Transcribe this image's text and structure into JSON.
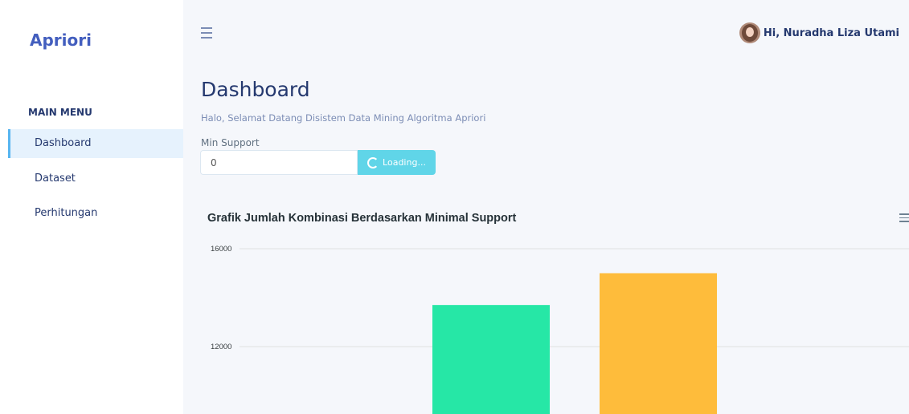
{
  "app": {
    "brand": "Apriori"
  },
  "sidebar": {
    "menu_title": "MAIN MENU",
    "items": [
      {
        "label": "Dashboard",
        "active": true
      },
      {
        "label": "Dataset",
        "active": false
      },
      {
        "label": "Perhitungan",
        "active": false
      }
    ]
  },
  "header": {
    "menu_icon": "hamburger-icon",
    "user_greeting": "Hi, Nuradha Liza Utami"
  },
  "main": {
    "title": "Dashboard",
    "subtitle": "Halo, Selamat Datang Disistem Data Mining Algoritma Apriori",
    "min_support": {
      "label": "Min Support",
      "value": "0",
      "button_label": "Loading..."
    }
  },
  "colors": {
    "accent": "#435ebe",
    "active_bg": "#e6f2fd",
    "button": "#60d5e8",
    "bar_1": "#26e7a6",
    "bar_2": "#febc3b"
  },
  "chart_data": {
    "type": "bar",
    "title": "Grafik Jumlah Kombinasi Berdasarkan Minimal Support",
    "series": [
      {
        "values": [
          13700,
          15000
        ]
      }
    ],
    "ytick_labels": [
      "16000",
      "12000"
    ],
    "yticks": [
      16000,
      12000
    ],
    "ylim_visible": [
      10000,
      16000
    ],
    "grid": true,
    "bar_colors": [
      "#26e7a6",
      "#febc3b"
    ]
  }
}
